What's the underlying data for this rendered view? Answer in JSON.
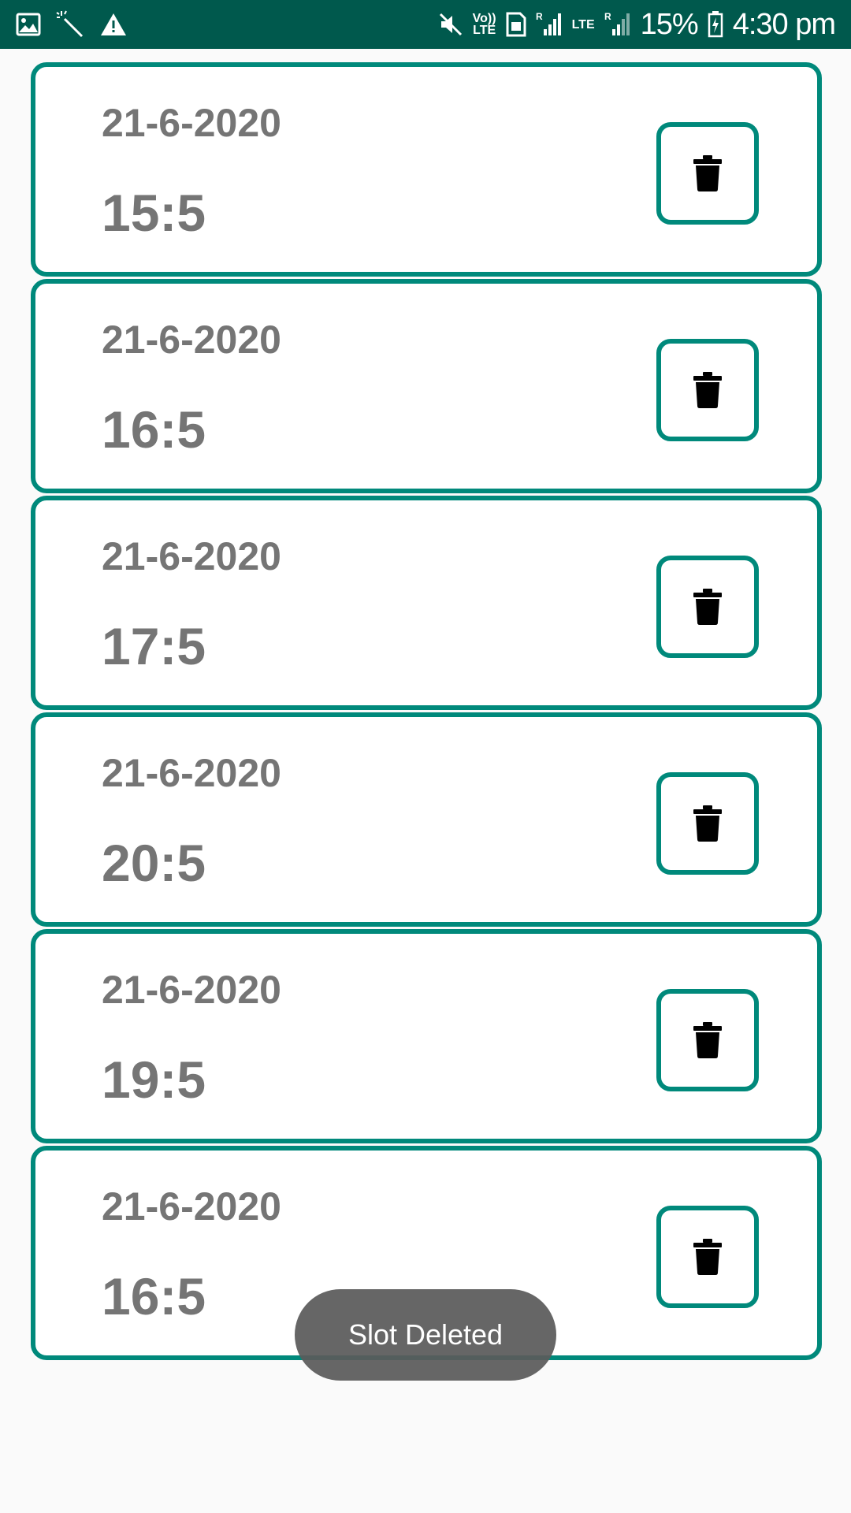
{
  "status_bar": {
    "left_icons": [
      "image-icon",
      "magic-wand-icon",
      "warning-icon"
    ],
    "volte_label_top": "Vo))",
    "volte_label_bottom": "LTE",
    "lte_label": "LTE",
    "roaming_label": "R",
    "battery": "15%",
    "time": "4:30 pm"
  },
  "slots": [
    {
      "date": "21-6-2020",
      "time": "15:5"
    },
    {
      "date": "21-6-2020",
      "time": "16:5"
    },
    {
      "date": "21-6-2020",
      "time": "17:5"
    },
    {
      "date": "21-6-2020",
      "time": "20:5"
    },
    {
      "date": "21-6-2020",
      "time": "19:5"
    },
    {
      "date": "21-6-2020",
      "time": "16:5"
    }
  ],
  "toast": {
    "message": "Slot Deleted"
  },
  "colors": {
    "status_bar": "#00594d",
    "accent": "#00897b",
    "text_gray": "#757575",
    "background": "#fafafa"
  }
}
